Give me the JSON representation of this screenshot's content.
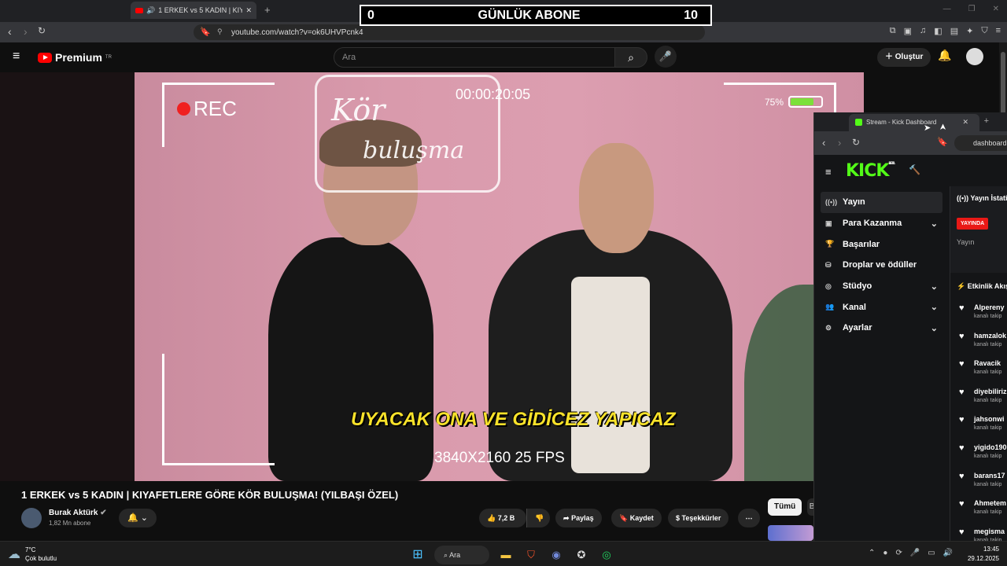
{
  "browser": {
    "tab_title": "1 ERKEK vs 5 KADIN | KIYAFE...",
    "url": "youtube.com/watch?v=ok6UHVPcnk4"
  },
  "overlay": {
    "left": "0",
    "title": "GÜNLÜK ABONE",
    "right": "10"
  },
  "youtube": {
    "brand": "Premium",
    "brand_sup": "TR",
    "search_placeholder": "Ara",
    "create_label": "Oluştur"
  },
  "video": {
    "rec": "REC",
    "timecode": "00:00:20:05",
    "battery": "75%",
    "battery_level": 0.75,
    "neon_line1": "Kör",
    "neon_line2": "buluşma",
    "subtitle": "UYACAK ONA VE GİDİCEZ YAPICAZ",
    "resolution": "3840X2160 25 FPS"
  },
  "info": {
    "title": "1 ERKEK vs 5 KADIN | KIYAFETLERE GÖRE KÖR BULUŞMA! (YILBAŞI ÖZEL)",
    "channel": "Burak Aktürk",
    "subscribers": "1,82 Mn abone",
    "likes": "7,2 B",
    "share": "Paylaş",
    "save": "Kaydet",
    "thanks": "Teşekkürler",
    "chip_all": "Tümü",
    "chip_b": "B"
  },
  "kick": {
    "tab_title": "Stream - Kick Dashboard",
    "url": "dashboard",
    "logo": "KICK",
    "logo_sup": "BETA",
    "nav": [
      {
        "label": "Yayın",
        "icon": "stream-icon",
        "glyph": "((•))",
        "chevron": false,
        "active": true
      },
      {
        "label": "Para Kazanma",
        "icon": "money-icon",
        "glyph": "▣",
        "chevron": true,
        "active": false
      },
      {
        "label": "Başarılar",
        "icon": "trophy-icon",
        "glyph": "🏆",
        "chevron": false,
        "active": false
      },
      {
        "label": "Droplar ve ödüller",
        "icon": "gift-icon",
        "glyph": "⛁",
        "chevron": false,
        "active": false
      },
      {
        "label": "Stüdyo",
        "icon": "studio-icon",
        "glyph": "◎",
        "chevron": true,
        "active": false
      },
      {
        "label": "Kanal",
        "icon": "channel-icon",
        "glyph": "👥",
        "chevron": true,
        "active": false
      },
      {
        "label": "Ayarlar",
        "icon": "settings-icon",
        "glyph": "⚙",
        "chevron": true,
        "active": false
      }
    ],
    "stats_title": "Yayın İstatis",
    "live_badge": "YAYINDA",
    "stream_label": "Yayın",
    "events_title": "Etkinlik Akış",
    "follows": [
      {
        "user": "Alpereny",
        "action": "kanalı takip"
      },
      {
        "user": "hamzalok",
        "action": "kanalı takip"
      },
      {
        "user": "Ravacik",
        "action": "kanalı takip"
      },
      {
        "user": "diyebiliriz",
        "action": "kanalı takip"
      },
      {
        "user": "jahsonwi",
        "action": "kanalı takip"
      },
      {
        "user": "yigido190",
        "action": "kanalı takip"
      },
      {
        "user": "barans17",
        "action": "kanalı takip"
      },
      {
        "user": "Ahmetem",
        "action": "kanalı takip"
      },
      {
        "user": "megisma",
        "action": "kanalı takip"
      }
    ]
  },
  "taskbar": {
    "temp": "7°C",
    "weather": "Çok bulutlu",
    "search": "Ara",
    "time": "13:45",
    "date": "29.12.2025"
  },
  "colors": {
    "kick_green": "#53fc18",
    "yt_red": "#ff0000",
    "live_red": "#e91916",
    "subtitle_yellow": "#f8e22a"
  }
}
